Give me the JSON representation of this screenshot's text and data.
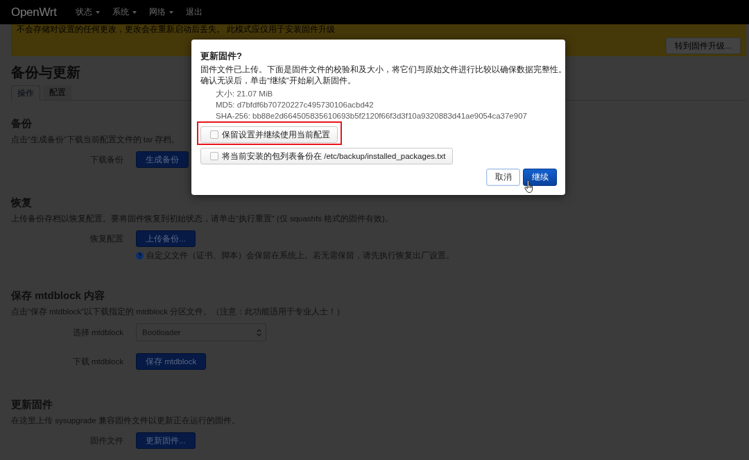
{
  "navbar": {
    "brand": "OpenWrt",
    "menu": [
      {
        "label": "状态",
        "dropdown": true
      },
      {
        "label": "系统",
        "dropdown": true
      },
      {
        "label": "网络",
        "dropdown": true
      },
      {
        "label": "退出",
        "dropdown": false
      }
    ]
  },
  "alert": {
    "text": "不会存储对设置的任何更改，更改会在重新启动后丢失。 此模式应仅用于安装固件升级",
    "button": "转到固件升级..."
  },
  "page_title": "备份与更新",
  "tabs": [
    {
      "label": "操作",
      "selected": true
    },
    {
      "label": "配置",
      "selected": false
    }
  ],
  "sections": [
    {
      "title": "备份",
      "description": "点击“生成备份”下载当前配置文件的 tar 存档。",
      "fields": [
        {
          "kind": "button",
          "label": "下载备份",
          "button": "生成备份"
        }
      ]
    },
    {
      "title": "恢复",
      "description": "上传备份存档以恢复配置。要将固件恢复到初始状态，请单击“执行重置” (仅 squashfs 格式的固件有效)。",
      "fields": [
        {
          "kind": "button",
          "label": "恢复配置",
          "button": "上传备份...",
          "help": "自定义文件（证书、脚本）会保留在系统上。若无需保留，请先执行恢复出厂设置。"
        }
      ]
    },
    {
      "title": "保存 mtdblock 内容",
      "description": "点击“保存 mtdblock”以下载指定的 mtdblock 分区文件。（注意：此功能适用于专业人士！）",
      "fields": [
        {
          "kind": "select",
          "label": "选择 mtdblock",
          "value": "Bootloader"
        },
        {
          "kind": "button",
          "label": "下载 mtdblock",
          "button": "保存 mtdblock"
        }
      ]
    },
    {
      "title": "更新固件",
      "description": "在这里上传 sysupgrade 兼容固件文件以更新正在运行的固件。",
      "fields": [
        {
          "kind": "button",
          "label": "固件文件",
          "button": "更新固件..."
        }
      ]
    }
  ],
  "dialog": {
    "title": "更新固件?",
    "description": [
      "固件文件已上传。下面是固件文件的校验和及大小，将它们与原始文件进行比较以确保数据完整性。",
      "确认无误后，单击“继续”开始刷入新固件。"
    ],
    "info": [
      "大小: 21.07 MiB",
      "MD5: d7bfdf6b70720227c495730106acbd42",
      "SHA-256: bb88e2d664505835610693b5f2120f66f3d3f10a9320883d41ae9054ca37e907"
    ],
    "options": [
      {
        "label": "保留设置并继续使用当前配置",
        "checked": false,
        "highlighted": true
      },
      {
        "label": "将当前安装的包列表备份在 /etc/backup/installed_packages.txt",
        "checked": false,
        "highlighted": false
      }
    ],
    "buttons": [
      {
        "label": "取消",
        "kind": "secondary"
      },
      {
        "label": "继续",
        "kind": "primary"
      }
    ]
  }
}
